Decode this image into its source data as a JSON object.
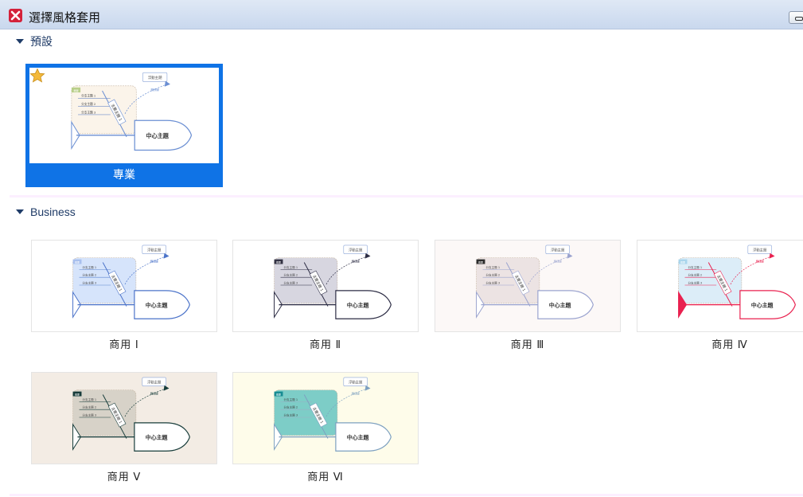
{
  "window": {
    "title": "選擇風格套用",
    "icon": "xmind-x-icon",
    "accent": "#d4213a"
  },
  "sections": {
    "default_label": "預設",
    "business_label": "Business"
  },
  "thumb_text": {
    "central": "中心主題",
    "main": "主要主題 1",
    "floating": "浮動主題",
    "relation": "關係線",
    "summary": "概要",
    "sub1": "分支主題 1",
    "sub2": "分支主題 2",
    "sub3": "分支主題 3"
  },
  "default_styles": [
    {
      "label": "專業",
      "selected": true,
      "favorite": true,
      "icon": "star-icon",
      "accent": "#0f73e6"
    }
  ],
  "business_styles": [
    {
      "label": "商用 Ⅰ",
      "bg": "#ffffff",
      "cloud": "#d6e4fb",
      "head": "#ffffff",
      "tail": "#ffffff",
      "line": "#5b85cf",
      "bone": "#4b73c9",
      "tag": "#a9c0ee"
    },
    {
      "label": "商用 Ⅱ",
      "bg": "#ffffff",
      "cloud": "#d7d6e0",
      "head": "#ffffff",
      "tail": "#ffffff",
      "line": "#2c2c44",
      "bone": "#2c2c44",
      "tag": "#333344"
    },
    {
      "label": "商用 Ⅲ",
      "bg": "#fcf8f7",
      "cloud": "#ece3e3",
      "head": "#ffffff",
      "tail": "#ffffff",
      "line": "#9aa3cf",
      "bone": "#9aa3cf",
      "tag": "#2d2d2d"
    },
    {
      "label": "商用 Ⅳ",
      "bg": "#ffffff",
      "cloud": "#dcedf8",
      "head": "#ffffff",
      "tail": "#e9214f",
      "line": "#e9214f",
      "bone": "#e9214f",
      "tag": "#a9d5ec"
    },
    {
      "label": "商用 Ⅴ",
      "bg": "#f3ece4",
      "cloud": "#d7d2c8",
      "head": "#ffffff",
      "tail": "#ffffff",
      "line": "#173c3a",
      "bone": "#173c3a",
      "tag": "#173c3a"
    },
    {
      "label": "商用 Ⅵ",
      "bg": "#fefcea",
      "cloud": "#7dcdc7",
      "head": "#ffffff",
      "tail": "#ffffff",
      "line": "#9db0c4",
      "bone": "#7da0c0",
      "tag": "#178c93"
    }
  ]
}
